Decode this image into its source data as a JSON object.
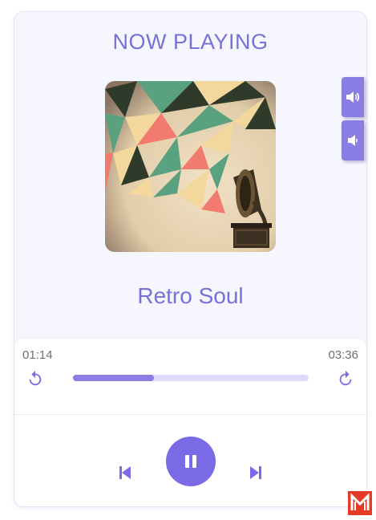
{
  "header": {
    "title": "NOW PLAYING"
  },
  "track": {
    "title": "Retro Soul",
    "current_time": "01:14",
    "total_time": "03:36",
    "progress": 0.3426
  },
  "icons": {
    "rewind": "rewind-icon",
    "forward": "forward-icon",
    "previous": "skip-previous-icon",
    "next": "skip-next-icon",
    "pause": "pause-icon",
    "volume_up": "volume-up-icon",
    "volume_down": "volume-down-icon",
    "brand": "brand-logo"
  },
  "colors": {
    "accent": "#7b6ae6",
    "accent_light": "#8a7ee4",
    "track_bg": "#dcdbfa",
    "card_bg": "#f6f7fe",
    "time_text": "#6f6f77",
    "brand_red": "#e53a26"
  }
}
